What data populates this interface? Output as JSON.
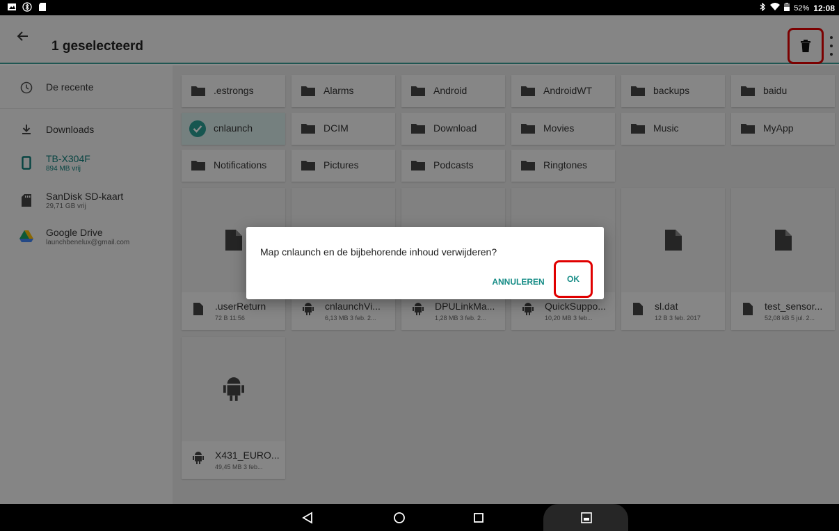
{
  "status_bar": {
    "battery": "52%",
    "time": "12:08"
  },
  "app_bar": {
    "title": "1 geselecteerd"
  },
  "drawer": {
    "items": [
      {
        "label": "De recente",
        "sub": "",
        "icon": "clock-icon"
      },
      {
        "label": "Downloads",
        "sub": "",
        "icon": "download-icon"
      },
      {
        "label": "TB-X304F",
        "sub": "894 MB vrij",
        "icon": "tablet-icon"
      },
      {
        "label": "SanDisk SD-kaart",
        "sub": "29,71 GB vrij",
        "icon": "sd-card-icon"
      },
      {
        "label": "Google Drive",
        "sub": "launchbenelux@gmail.com",
        "icon": "google-drive-icon"
      }
    ]
  },
  "folders": [
    {
      "name": ".estrongs"
    },
    {
      "name": "Alarms"
    },
    {
      "name": "Android"
    },
    {
      "name": "AndroidWT"
    },
    {
      "name": "backups"
    },
    {
      "name": "baidu"
    },
    {
      "name": "cnlaunch",
      "selected": true
    },
    {
      "name": "DCIM"
    },
    {
      "name": "Download"
    },
    {
      "name": "Movies"
    },
    {
      "name": "Music"
    },
    {
      "name": "MyApp"
    },
    {
      "name": "Notifications"
    },
    {
      "name": "Pictures"
    },
    {
      "name": "Podcasts"
    },
    {
      "name": "Ringtones"
    }
  ],
  "files": [
    {
      "name": ".userReturn",
      "meta": "72 B 11:56",
      "type": "file"
    },
    {
      "name": "cnlaunchVi...",
      "meta": "6,13 MB 3 feb. 2...",
      "type": "apk"
    },
    {
      "name": "DPULinkMa...",
      "meta": "1,28 MB 3 feb. 2...",
      "type": "apk"
    },
    {
      "name": "QuickSuppo...",
      "meta": "10,20 MB 3 feb...",
      "type": "apk"
    },
    {
      "name": "sl.dat",
      "meta": "12 B 3 feb. 2017",
      "type": "file"
    },
    {
      "name": "test_sensor...",
      "meta": "52,08 kB 5 jul. 2...",
      "type": "file"
    },
    {
      "name": "X431_EURO...",
      "meta": "49,45 MB 3 feb...",
      "type": "apk"
    }
  ],
  "dialog": {
    "message": "Map cnlaunch en de bijbehorende inhoud verwijderen?",
    "cancel_label": "ANNULEREN",
    "ok_label": "OK"
  },
  "colors": {
    "accent": "#168c86",
    "highlight_box": "#e00000"
  }
}
